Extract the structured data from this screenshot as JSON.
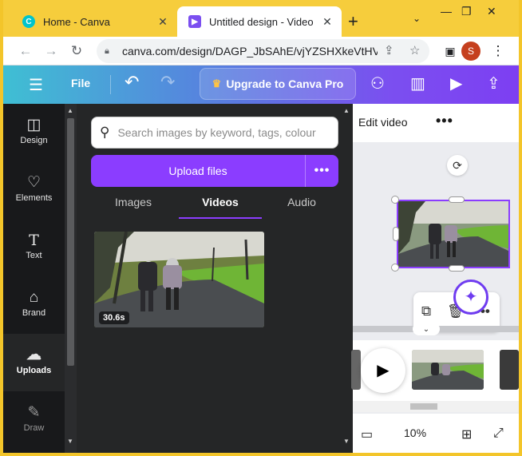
{
  "browser": {
    "tabs": [
      {
        "title": "Home - Canva",
        "favicon": "canva-icon",
        "color": "#7d2ae8"
      },
      {
        "title": "Untitled design - Video",
        "favicon": "video-icon",
        "color": "#7b4ff0"
      }
    ],
    "url": "canva.com/design/DAGP_JbSAhE/vjYZSHXkeVtHV...",
    "avatar_letter": "S"
  },
  "header": {
    "file_label": "File",
    "upgrade_label": "Upgrade to Canva Pro"
  },
  "sidebar": {
    "items": [
      {
        "label": "Design",
        "icon": "design-icon"
      },
      {
        "label": "Elements",
        "icon": "elements-icon"
      },
      {
        "label": "Text",
        "icon": "text-icon"
      },
      {
        "label": "Brand",
        "icon": "brand-icon"
      },
      {
        "label": "Uploads",
        "icon": "uploads-icon"
      },
      {
        "label": "Draw",
        "icon": "draw-icon"
      }
    ]
  },
  "panel": {
    "search_placeholder": "Search images by keyword, tags, colour",
    "upload_label": "Upload files",
    "tabs": [
      "Images",
      "Videos",
      "Audio"
    ],
    "active_tab": "Videos",
    "video_duration": "30.6s"
  },
  "editor": {
    "edit_video_label": "Edit video",
    "zoom": "10%"
  }
}
